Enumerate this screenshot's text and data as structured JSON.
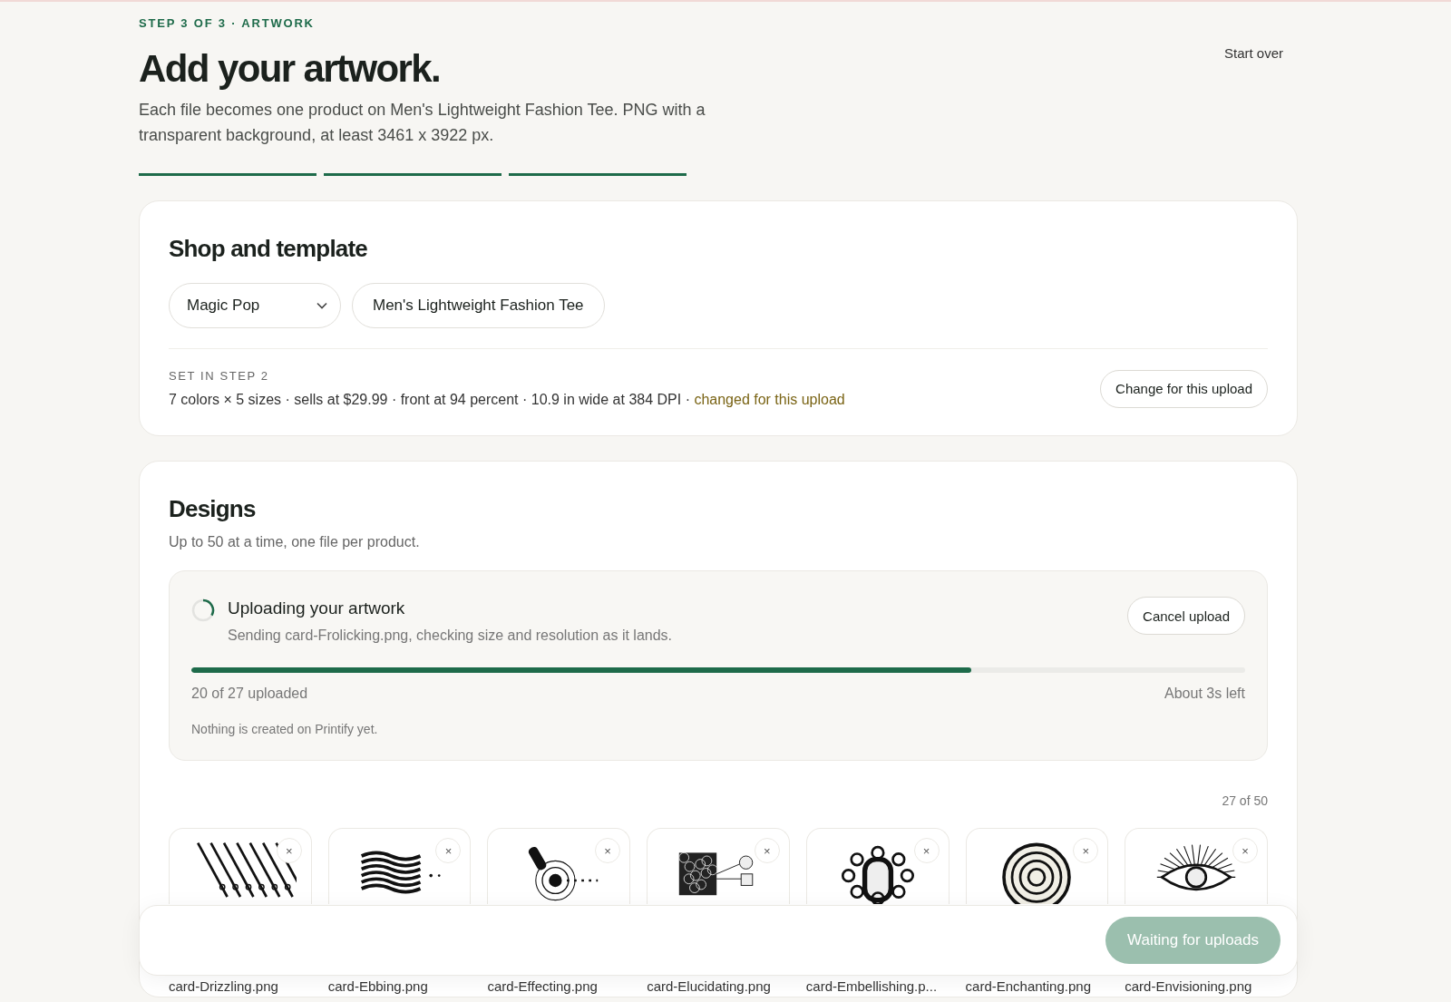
{
  "step_label": "STEP 3 OF 3 · ARTWORK",
  "title": "Add your artwork.",
  "description": "Each file becomes one product on Men's Lightweight Fashion Tee. PNG with a transparent background, at least 3461 x 3922 px.",
  "start_over": "Start over",
  "steps": [
    {
      "done": true
    },
    {
      "done": true
    },
    {
      "done": true
    }
  ],
  "shop_card": {
    "heading": "Shop and template",
    "shop": "Magic Pop",
    "template": "Men's Lightweight Fashion Tee",
    "set_label": "SET IN STEP 2",
    "details": "7 colors × 5 sizes · sells at $29.99 · front at 94 percent · 10.9 in wide at 384 DPI · ",
    "changed_note": "changed for this upload",
    "change_button": "Change for this upload"
  },
  "designs": {
    "heading": "Designs",
    "subtitle": "Up to 50 at a time, one file per product.",
    "upload": {
      "title": "Uploading your artwork",
      "detail": "Sending card-Frolicking.png, checking size and resolution as it lands.",
      "cancel": "Cancel upload",
      "level": 0.74,
      "progress_text": "20 of 27 uploaded",
      "time_left": "About 3s left",
      "note": "Nothing is created on Printify yet."
    },
    "count": "27 of 50",
    "files": [
      {
        "name": "card-Drizzling.png",
        "kind": "lines",
        "remove": "×"
      },
      {
        "name": "card-Ebbing.png",
        "kind": "waves",
        "remove": "×"
      },
      {
        "name": "card-Effecting.png",
        "kind": "target",
        "remove": "×"
      },
      {
        "name": "card-Elucidating.png",
        "kind": "tangle",
        "remove": "×"
      },
      {
        "name": "card-Embellishing.p...",
        "kind": "swirls",
        "remove": "×"
      },
      {
        "name": "card-Enchanting.png",
        "kind": "spiral",
        "remove": "×"
      },
      {
        "name": "card-Envisioning.png",
        "kind": "eye",
        "remove": "×"
      }
    ]
  },
  "footer": {
    "button": "Waiting for uploads",
    "disabled": true
  }
}
